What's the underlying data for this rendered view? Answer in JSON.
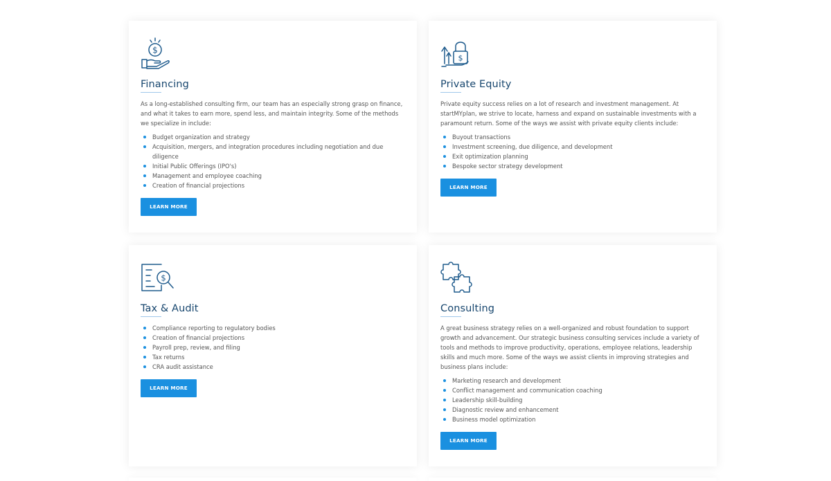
{
  "cards": [
    {
      "title": "Financing",
      "icon": "money-hand-icon",
      "description": "As a long-established consulting firm, our team has an especially strong grasp on finance, and what it takes to earn more, spend less, and maintain integrity. Some of the methods we specialize in include:",
      "items": [
        "Budget organization and strategy",
        "Acquisition, mergers, and integration procedures including negotiation and due diligence",
        "Initial Public Offerings (IPO's)",
        "Management and employee coaching",
        "Creation of financial projections"
      ],
      "button": "Learn More"
    },
    {
      "title": "Private Equity",
      "icon": "lock-growth-icon",
      "description": "Private equity success relies on a lot of research and investment management. At startMYplan, we strive to locate, harness and expand on sustainable investments with a paramount return. Some of the ways we assist with private equity clients include:",
      "items": [
        "Buyout transactions",
        "Investment screening, due diligence, and development",
        "Exit optimization planning",
        "Bespoke sector strategy development"
      ],
      "button": "Learn More"
    },
    {
      "title": "Tax & Audit",
      "icon": "document-search-icon",
      "description": "",
      "items": [
        "Compliance reporting to regulatory bodies",
        "Creation of financial projections",
        "Payroll prep, review, and filing",
        "Tax returns",
        "CRA audit assistance"
      ],
      "button": "Learn More"
    },
    {
      "title": "Consulting",
      "icon": "puzzle-icon",
      "description": "A great business strategy relies on a well-organized and robust foundation to support growth and advancement. Our strategic business consulting services include a variety of tools and methods to improve productivity, operations, employee relations, leadership skills and much more. Some of the ways we assist clients in improving strategies and business plans include:",
      "items": [
        "Marketing research and development",
        "Conflict management and communication coaching",
        "Leadership skill-building",
        "Diagnostic review and enhancement",
        "Business model optimization"
      ],
      "button": "Learn More"
    }
  ],
  "colors": {
    "accent": "#1a90e0",
    "title": "#17466e",
    "icon": "#1d5a8c"
  }
}
